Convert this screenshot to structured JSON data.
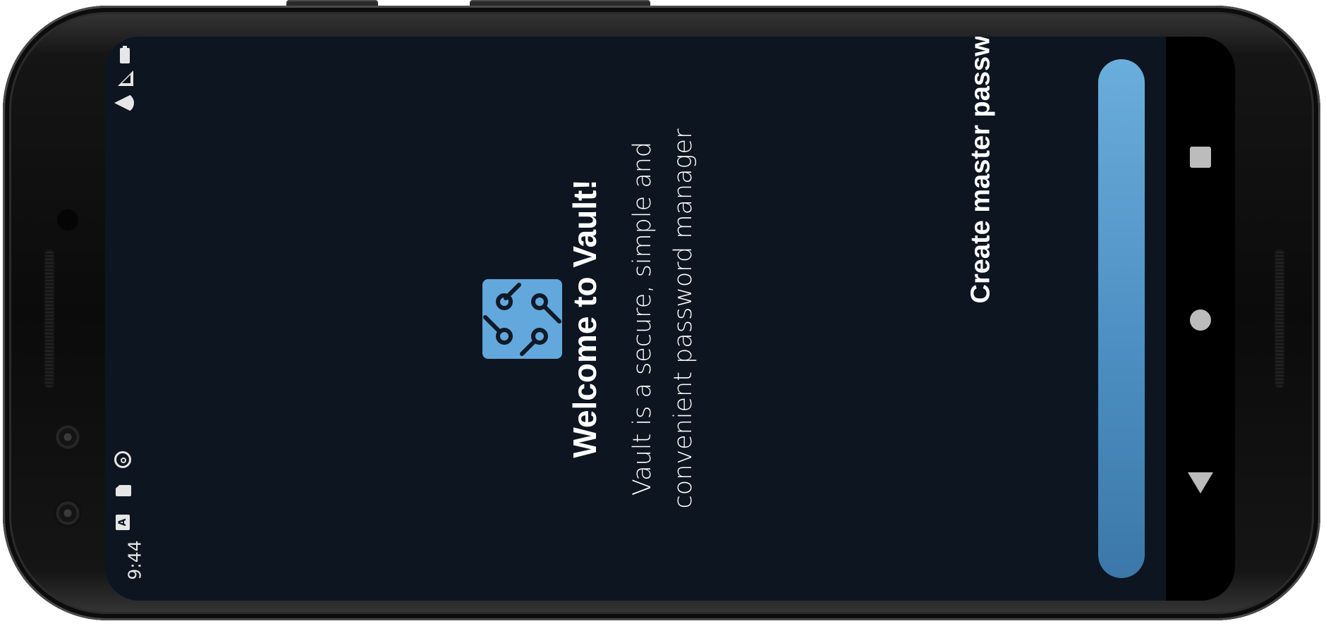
{
  "status_bar": {
    "time": "9:44",
    "icons": [
      "battery-icon",
      "signal-icon",
      "wifi-icon",
      "sync-icon",
      "sd-card-icon",
      "keyboard-a-icon"
    ],
    "a_icon_letter": "A"
  },
  "app": {
    "logo_icon": "circuit-logo-icon",
    "title": "Welcome to Vault!",
    "subtitle_line1": "Vault is a secure, simple and",
    "subtitle_line2": "convenient password manager",
    "cta_label": "Create master password"
  },
  "nav_bar": {
    "icons": [
      "recents-square-icon",
      "home-circle-icon",
      "back-triangle-icon"
    ]
  },
  "colors": {
    "screen_bg": "#0d1520",
    "accent": "#5aa0d4",
    "logo_bg": "#62a8dc",
    "text": "#ffffff"
  }
}
